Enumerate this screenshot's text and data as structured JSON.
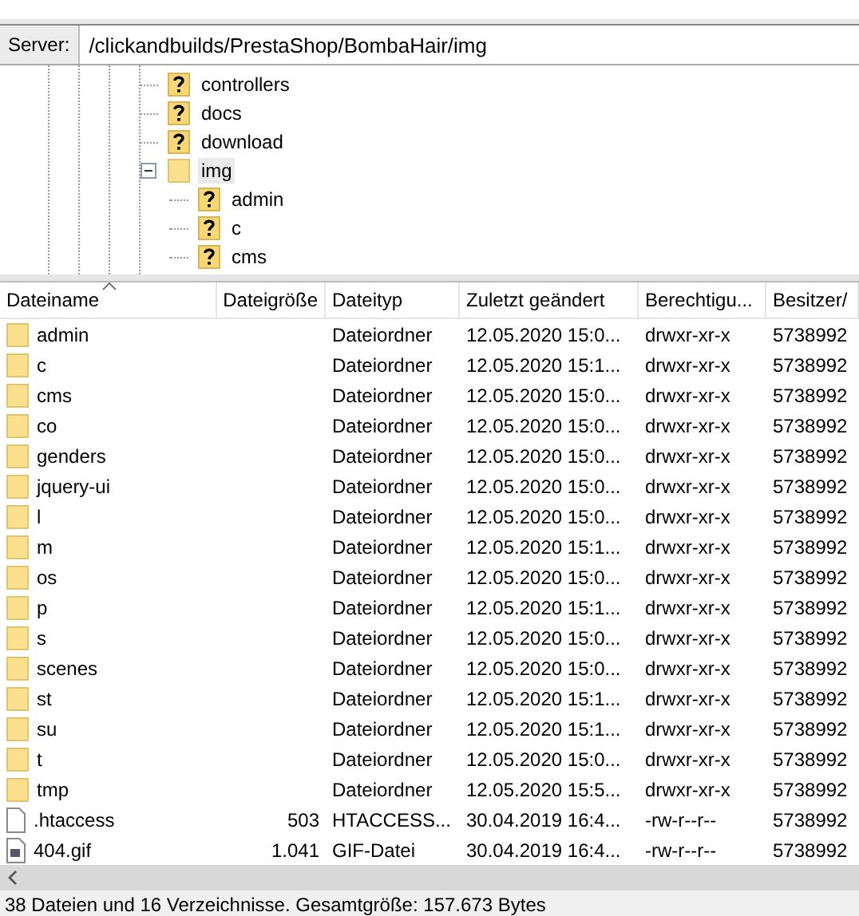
{
  "server_bar": {
    "label": "Server:",
    "path": "/clickandbuilds/PrestaShop/BombaHair/img"
  },
  "tree": [
    {
      "name": "controllers",
      "kind": "unknown"
    },
    {
      "name": "docs",
      "kind": "unknown"
    },
    {
      "name": "download",
      "kind": "unknown"
    },
    {
      "name": "img",
      "kind": "folder",
      "expanded": true,
      "selected": true,
      "children": [
        {
          "name": "admin",
          "kind": "unknown"
        },
        {
          "name": "c",
          "kind": "unknown"
        },
        {
          "name": "cms",
          "kind": "unknown"
        }
      ]
    }
  ],
  "table": {
    "columns": [
      {
        "label": "Dateiname",
        "sorted": true
      },
      {
        "label": "Dateigröße",
        "sorted": false
      },
      {
        "label": "Dateityp",
        "sorted": false
      },
      {
        "label": "Zuletzt geändert",
        "sorted": false
      },
      {
        "label": "Berechtigu...",
        "sorted": false
      },
      {
        "label": "Besitzer/",
        "sorted": false
      }
    ],
    "rows": [
      {
        "kind": "folder",
        "name": "admin",
        "size": "",
        "type": "Dateiordner",
        "modified": "12.05.2020 15:0...",
        "perms": "drwxr-xr-x",
        "owner": "5738992"
      },
      {
        "kind": "folder",
        "name": "c",
        "size": "",
        "type": "Dateiordner",
        "modified": "12.05.2020 15:1...",
        "perms": "drwxr-xr-x",
        "owner": "5738992"
      },
      {
        "kind": "folder",
        "name": "cms",
        "size": "",
        "type": "Dateiordner",
        "modified": "12.05.2020 15:0...",
        "perms": "drwxr-xr-x",
        "owner": "5738992"
      },
      {
        "kind": "folder",
        "name": "co",
        "size": "",
        "type": "Dateiordner",
        "modified": "12.05.2020 15:0...",
        "perms": "drwxr-xr-x",
        "owner": "5738992"
      },
      {
        "kind": "folder",
        "name": "genders",
        "size": "",
        "type": "Dateiordner",
        "modified": "12.05.2020 15:0...",
        "perms": "drwxr-xr-x",
        "owner": "5738992"
      },
      {
        "kind": "folder",
        "name": "jquery-ui",
        "size": "",
        "type": "Dateiordner",
        "modified": "12.05.2020 15:0...",
        "perms": "drwxr-xr-x",
        "owner": "5738992"
      },
      {
        "kind": "folder",
        "name": "l",
        "size": "",
        "type": "Dateiordner",
        "modified": "12.05.2020 15:0...",
        "perms": "drwxr-xr-x",
        "owner": "5738992"
      },
      {
        "kind": "folder",
        "name": "m",
        "size": "",
        "type": "Dateiordner",
        "modified": "12.05.2020 15:1...",
        "perms": "drwxr-xr-x",
        "owner": "5738992"
      },
      {
        "kind": "folder",
        "name": "os",
        "size": "",
        "type": "Dateiordner",
        "modified": "12.05.2020 15:0...",
        "perms": "drwxr-xr-x",
        "owner": "5738992"
      },
      {
        "kind": "folder",
        "name": "p",
        "size": "",
        "type": "Dateiordner",
        "modified": "12.05.2020 15:1...",
        "perms": "drwxr-xr-x",
        "owner": "5738992"
      },
      {
        "kind": "folder",
        "name": "s",
        "size": "",
        "type": "Dateiordner",
        "modified": "12.05.2020 15:0...",
        "perms": "drwxr-xr-x",
        "owner": "5738992"
      },
      {
        "kind": "folder",
        "name": "scenes",
        "size": "",
        "type": "Dateiordner",
        "modified": "12.05.2020 15:0...",
        "perms": "drwxr-xr-x",
        "owner": "5738992"
      },
      {
        "kind": "folder",
        "name": "st",
        "size": "",
        "type": "Dateiordner",
        "modified": "12.05.2020 15:1...",
        "perms": "drwxr-xr-x",
        "owner": "5738992"
      },
      {
        "kind": "folder",
        "name": "su",
        "size": "",
        "type": "Dateiordner",
        "modified": "12.05.2020 15:1...",
        "perms": "drwxr-xr-x",
        "owner": "5738992"
      },
      {
        "kind": "folder",
        "name": "t",
        "size": "",
        "type": "Dateiordner",
        "modified": "12.05.2020 15:0...",
        "perms": "drwxr-xr-x",
        "owner": "5738992"
      },
      {
        "kind": "folder",
        "name": "tmp",
        "size": "",
        "type": "Dateiordner",
        "modified": "12.05.2020 15:5...",
        "perms": "drwxr-xr-x",
        "owner": "5738992"
      },
      {
        "kind": "file",
        "name": ".htaccess",
        "size": "503",
        "type": "HTACCESS...",
        "modified": "30.04.2019 16:4...",
        "perms": "-rw-r--r--",
        "owner": "5738992"
      },
      {
        "kind": "image",
        "name": "404.gif",
        "size": "1.041",
        "type": "GIF-Datei",
        "modified": "30.04.2019 16:4...",
        "perms": "-rw-r--r--",
        "owner": "5738992"
      }
    ]
  },
  "status_bar": "38 Dateien und 16 Verzeichnisse. Gesamtgröße: 157.673 Bytes"
}
